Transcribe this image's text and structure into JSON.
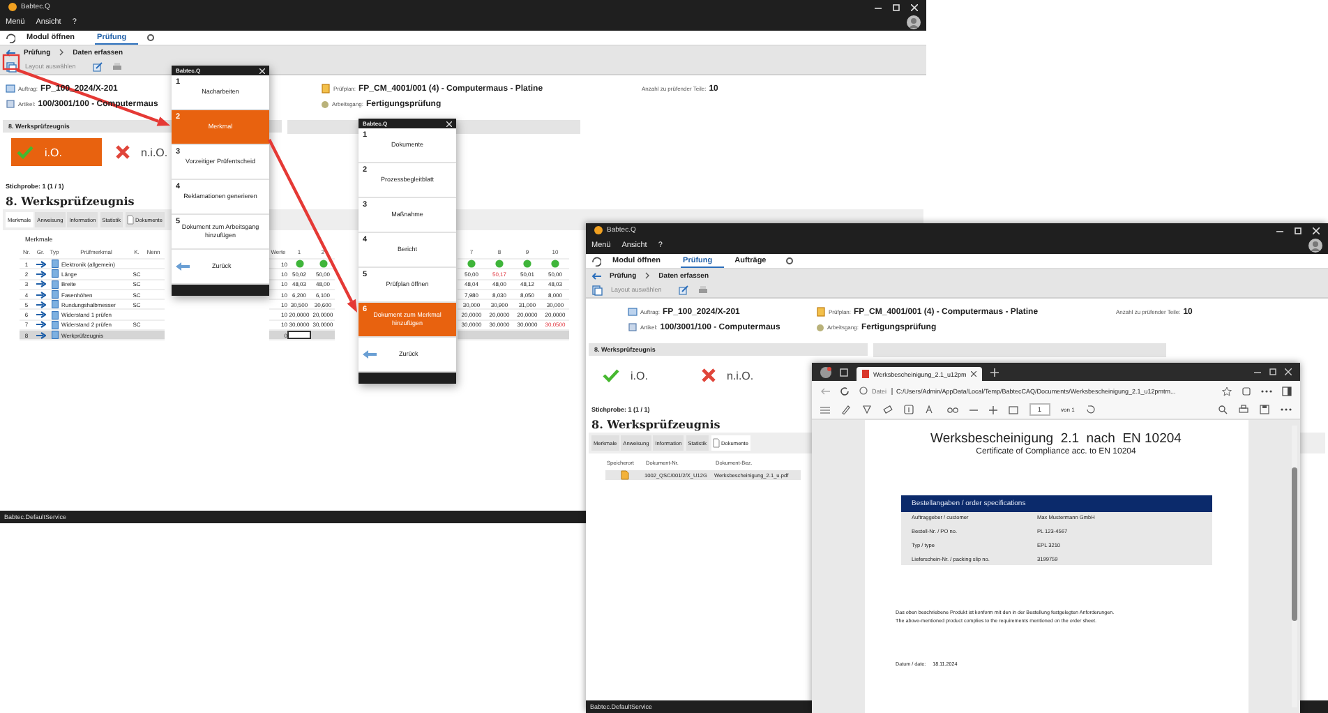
{
  "app_windows": [
    {
      "title": "Babtec.Q",
      "menu": [
        "Menü",
        "Ansicht",
        "?"
      ],
      "module_tabs": [
        {
          "label": "Modul öffnen",
          "selected": false
        },
        {
          "label": "Prüfung",
          "selected": true
        }
      ],
      "breadcrumb": [
        "Prüfung",
        "Daten erfassen"
      ],
      "layout_label": "Layout auswählen",
      "header": {
        "auftrag_label": "Auftrag:",
        "auftrag": "FP_100_2024/X-201",
        "artikel_label": "Artikel:",
        "artikel": "100/3001/100 - Computermaus",
        "pruefplan_label": "Prüfplan:",
        "pruefplan": "FP_CM_4001/001 (4) - Computermaus - Platine",
        "arbeitsgang_label": "Arbeitsgang:",
        "arbeitsgang": "Fertigungsprüfung",
        "anzahl_label": "Anzahl zu prüfender Teile:",
        "anzahl": "10"
      },
      "decision": {
        "title": "8. Werksprüfzeugnis",
        "buttons": [
          {
            "label": "i.O.",
            "kind": "ok",
            "selected": true
          },
          {
            "label": "n.i.O.",
            "kind": "nok",
            "selected": false
          }
        ]
      },
      "stichprobe": "Stichprobe: 1 (1 / 1)",
      "section_title": "8. Werksprüfzeugnis",
      "sub_tabs": [
        {
          "label": "Merkmale",
          "selected": true
        },
        {
          "label": "Anweisung",
          "selected": false
        },
        {
          "label": "Information",
          "selected": false
        },
        {
          "label": "Statistik",
          "selected": false
        },
        {
          "label": "Dokumente",
          "selected": false
        }
      ],
      "table": {
        "kind": "merkmale",
        "group": "Merkmale",
        "columns": [
          "Nr.",
          "Gr.",
          "Typ",
          "Prüfmerkmal",
          "K.",
          "Nenn",
          "Werte",
          "1",
          "2",
          "7",
          "8",
          "9",
          "10"
        ],
        "rows": [
          {
            "nr": "1",
            "name": "Elektronik (allgemein)",
            "werte": "10",
            "selected": false,
            "values": [
              {
                "kind": "dot",
                "ok": true
              },
              {
                "kind": "dot",
                "ok": true
              },
              {
                "kind": "dot",
                "ok": true
              },
              {
                "kind": "dot",
                "ok": true
              },
              {
                "kind": "dot",
                "ok": true
              },
              {
                "kind": "dot",
                "ok": true
              }
            ]
          },
          {
            "nr": "2",
            "name": "Länge",
            "k": "SC",
            "werte": "10",
            "selected": false,
            "values": [
              {
                "kind": "value",
                "text": "50,02",
                "ok": true
              },
              {
                "kind": "value",
                "text": "50,00",
                "ok": true
              },
              {
                "kind": "value",
                "text": "50,00",
                "ok": true
              },
              {
                "kind": "value",
                "text": "50,17",
                "ok": false
              },
              {
                "kind": "value",
                "text": "50,01",
                "ok": true
              },
              {
                "kind": "value",
                "text": "50,00",
                "ok": true
              }
            ]
          },
          {
            "nr": "3",
            "name": "Breite",
            "k": "SC",
            "werte": "10",
            "selected": false,
            "values": [
              {
                "kind": "value",
                "text": "48,03",
                "ok": true
              },
              {
                "kind": "value",
                "text": "48,00",
                "ok": true
              },
              {
                "kind": "value",
                "text": "48,04",
                "ok": true
              },
              {
                "kind": "value",
                "text": "48,00",
                "ok": true
              },
              {
                "kind": "value",
                "text": "48,12",
                "ok": true
              },
              {
                "kind": "value",
                "text": "48,03",
                "ok": true
              }
            ]
          },
          {
            "nr": "4",
            "name": "Fasenhöhen",
            "k": "SC",
            "werte": "10",
            "selected": false,
            "values": [
              {
                "kind": "value",
                "text": "6,200",
                "ok": true
              },
              {
                "kind": "value",
                "text": "6,100",
                "ok": true
              },
              {
                "kind": "value",
                "text": "7,980",
                "ok": true
              },
              {
                "kind": "value",
                "text": "8,030",
                "ok": true
              },
              {
                "kind": "value",
                "text": "8,050",
                "ok": true
              },
              {
                "kind": "value",
                "text": "8,000",
                "ok": true
              }
            ]
          },
          {
            "nr": "5",
            "name": "Rundungshalbmesser",
            "k": "SC",
            "werte": "10",
            "selected": false,
            "values": [
              {
                "kind": "value",
                "text": "30,500",
                "ok": true
              },
              {
                "kind": "value",
                "text": "30,600",
                "ok": true
              },
              {
                "kind": "value",
                "text": "30,000",
                "ok": true
              },
              {
                "kind": "value",
                "text": "30,900",
                "ok": true
              },
              {
                "kind": "value",
                "text": "31,000",
                "ok": true
              },
              {
                "kind": "value",
                "text": "30,000",
                "ok": true
              }
            ]
          },
          {
            "nr": "6",
            "name": "Widerstand 1 prüfen",
            "werte": "10",
            "selected": false,
            "values": [
              {
                "kind": "value",
                "text": "20,0000",
                "ok": true
              },
              {
                "kind": "value",
                "text": "20,0000",
                "ok": true
              },
              {
                "kind": "value",
                "text": "20,0000",
                "ok": true
              },
              {
                "kind": "value",
                "text": "20,0000",
                "ok": true
              },
              {
                "kind": "value",
                "text": "20,0000",
                "ok": true
              },
              {
                "kind": "value",
                "text": "20,0000",
                "ok": true
              }
            ]
          },
          {
            "nr": "7",
            "name": "Widerstand 2 prüfen",
            "k": "SC",
            "werte": "10",
            "selected": false,
            "values": [
              {
                "kind": "value",
                "text": "30,0000",
                "ok": true
              },
              {
                "kind": "value",
                "text": "30,0000",
                "ok": true
              },
              {
                "kind": "value",
                "text": "30,0000",
                "ok": true
              },
              {
                "kind": "value",
                "text": "30,0000",
                "ok": true
              },
              {
                "kind": "value",
                "text": "30,0000",
                "ok": true
              },
              {
                "kind": "value",
                "text": "30,0500",
                "ok": false
              }
            ]
          },
          {
            "nr": "8",
            "name": "Werkprüfzeugnis",
            "werte": "0",
            "selected": true,
            "values": [
              {
                "kind": "input"
              }
            ]
          }
        ]
      },
      "status_bar": "Babtec.DefaultService"
    },
    {
      "title": "Babtec.Q",
      "menu": [
        "Menü",
        "Ansicht",
        "?"
      ],
      "module_tabs": [
        {
          "label": "Modul öffnen",
          "selected": false
        },
        {
          "label": "Prüfung",
          "selected": true
        },
        {
          "label": "Aufträge",
          "selected": false
        }
      ],
      "breadcrumb": [
        "Prüfung",
        "Daten erfassen"
      ],
      "layout_label": "Layout auswählen",
      "header": {
        "auftrag_label": "Auftrag:",
        "auftrag": "FP_100_2024/X-201",
        "artikel_label": "Artikel:",
        "artikel": "100/3001/100 - Computermaus",
        "pruefplan_label": "Prüfplan:",
        "pruefplan": "FP_CM_4001/001 (4) - Computermaus - Platine",
        "arbeitsgang_label": "Arbeitsgang:",
        "arbeitsgang": "Fertigungsprüfung",
        "anzahl_label": "Anzahl zu prüfender Teile:",
        "anzahl": "10"
      },
      "decision": {
        "title": "8. Werksprüfzeugnis",
        "buttons": [
          {
            "label": "i.O.",
            "kind": "ok",
            "selected": false
          },
          {
            "label": "n.i.O.",
            "kind": "nok",
            "selected": false
          }
        ]
      },
      "stichprobe": "Stichprobe: 1 (1 / 1)",
      "section_title": "8. Werksprüfzeugnis",
      "sub_tabs": [
        {
          "label": "Merkmale",
          "selected": false
        },
        {
          "label": "Anweisung",
          "selected": false
        },
        {
          "label": "Information",
          "selected": false
        },
        {
          "label": "Statistik",
          "selected": false
        },
        {
          "label": "Dokumente",
          "selected": true
        }
      ],
      "table": {
        "kind": "dokumente",
        "columns": [
          "Speicherort",
          "Dokument-Nr.",
          "Dokument-Bez."
        ],
        "rows": [
          {
            "number": "1002_QSC/001/2/X_U12G",
            "name": "Werksbescheinigung_2.1_u.pdf"
          }
        ]
      },
      "status_bar": "Babtec.DefaultService"
    }
  ],
  "dialogs": [
    {
      "title": "Babtec.Q",
      "items": [
        {
          "number": "1",
          "label": "Nacharbeiten",
          "selected": false
        },
        {
          "number": "2",
          "label": "Merkmal",
          "selected": true
        },
        {
          "number": "3",
          "label": "Vorzeitiger Prüfentscheid",
          "selected": false
        },
        {
          "number": "4",
          "label": "Reklamationen generieren",
          "selected": false
        },
        {
          "number": "5",
          "label": "Dokument zum Arbeitsgang hinzufügen",
          "selected": false
        }
      ],
      "back": "Zurück"
    },
    {
      "title": "Babtec.Q",
      "items": [
        {
          "number": "1",
          "label": "Dokumente",
          "selected": false
        },
        {
          "number": "2",
          "label": "Prozessbegleitblatt",
          "selected": false
        },
        {
          "number": "3",
          "label": "Maßnahme",
          "selected": false
        },
        {
          "number": "4",
          "label": "Bericht",
          "selected": false
        },
        {
          "number": "5",
          "label": "Prüfplan öffnen",
          "selected": false
        },
        {
          "number": "6",
          "label": "Dokument zum Merkmal hinzufügen",
          "selected": true
        }
      ],
      "back": "Zurück"
    }
  ],
  "pdf_viewer": {
    "tab_title": "Werksbescheinigung_2.1_u12pm",
    "address_scheme": "Datei",
    "address": "C:/Users/Admin/AppData/Local/Temp/BabtecCAQ/Documents/Werksbescheinigung_2.1_u12pmtm...",
    "page": "1",
    "page_total": "von 1",
    "document": {
      "title": "Werksbescheinigung  2.1  nach  EN 10204",
      "subtitle": "Certificate of Compliance acc. to EN 10204",
      "table_title": "Bestellangaben / order specifications",
      "rows": [
        {
          "label": "Auftraggeber / customer",
          "value": "Max Mustermann GmbH"
        },
        {
          "label": "Bestell-Nr. / PO no.",
          "value": "PL 123-4567"
        },
        {
          "label": "Typ / type",
          "value": "EPL 3210"
        },
        {
          "label": "Lieferschein-Nr. / packing slip no.",
          "value": "3199759"
        }
      ],
      "paragraph": [
        "Das oben beschriebene Produkt ist konform mit den in der Bestellung festgelegten Anforderungen.",
        "The above-mentioned product complies to the requirements mentioned on the order sheet."
      ],
      "date_label": "Datum / date:",
      "date": "18.11.2024"
    }
  }
}
